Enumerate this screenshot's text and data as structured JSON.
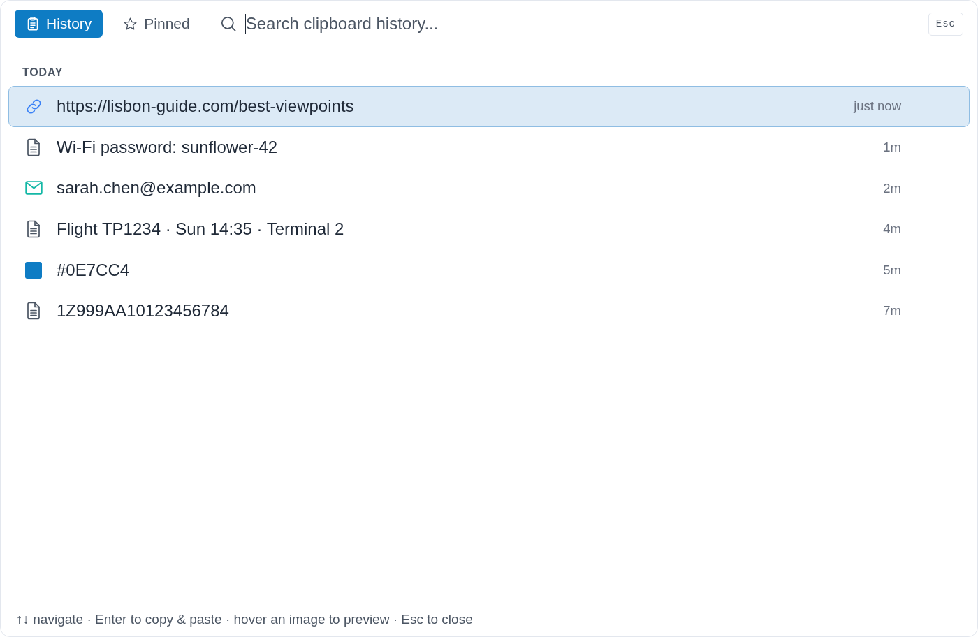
{
  "tabs": [
    {
      "kind": "history",
      "label": "History",
      "selected": true
    },
    {
      "kind": "pinned",
      "label": "Pinned",
      "selected": false
    }
  ],
  "search": {
    "placeholder": "Search clipboard history...",
    "focused": true
  },
  "close_key": "Esc",
  "sections": [
    {
      "title": "TODAY",
      "items": [
        {
          "kind": "link",
          "text": "https://lisbon-guide.com/best-viewpoints",
          "time": "just now",
          "selected": true
        },
        {
          "kind": "text",
          "text": "Wi-Fi password: sunflower-42",
          "time": "1m",
          "selected": false
        },
        {
          "kind": "email",
          "text": "sarah.chen@example.com",
          "time": "2m",
          "selected": false
        },
        {
          "kind": "text",
          "text": "Flight TP1234 · Sun 14:35 · Terminal 2",
          "time": "4m",
          "selected": false
        },
        {
          "kind": "color",
          "text": "#0E7CC4",
          "color": "#0e7cc4",
          "time": "5m",
          "selected": false
        },
        {
          "kind": "text",
          "text": "1Z999AA10123456784",
          "time": "7m",
          "selected": false
        }
      ]
    }
  ],
  "footer": "↑↓ navigate · Enter to copy & paste · hover an image to preview · Esc to close"
}
